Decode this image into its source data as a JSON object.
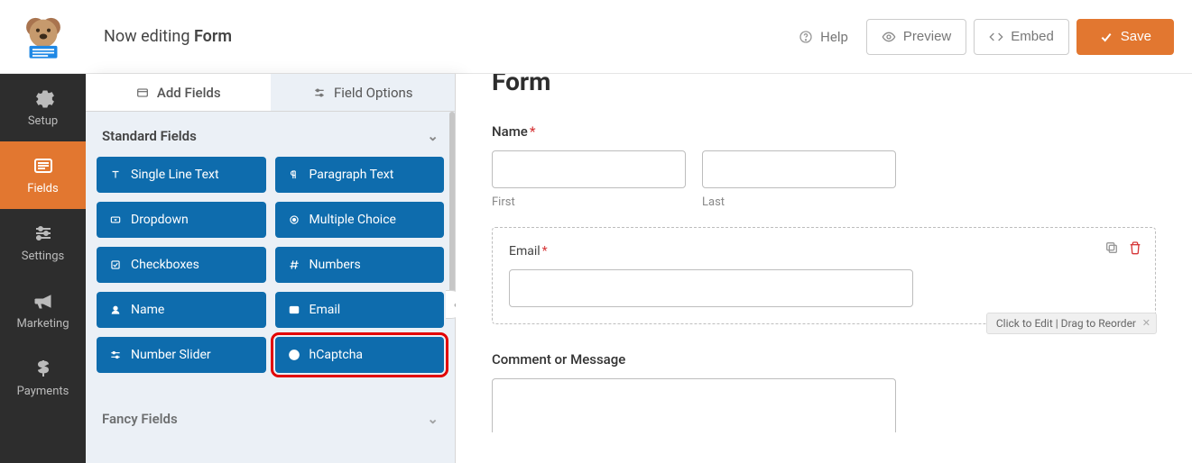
{
  "header": {
    "editing_prefix": "Now editing ",
    "editing_name": "Form",
    "help": "Help",
    "preview": "Preview",
    "embed": "Embed",
    "save": "Save"
  },
  "nav": {
    "setup": "Setup",
    "fields": "Fields",
    "settings": "Settings",
    "marketing": "Marketing",
    "payments": "Payments"
  },
  "panel": {
    "tabs": {
      "add": "Add Fields",
      "options": "Field Options"
    },
    "section_standard": "Standard Fields",
    "section_fancy": "Fancy Fields",
    "items": [
      "Single Line Text",
      "Paragraph Text",
      "Dropdown",
      "Multiple Choice",
      "Checkboxes",
      "Numbers",
      "Name",
      "Email",
      "Number Slider",
      "hCaptcha"
    ]
  },
  "form": {
    "title": "Form",
    "name_label": "Name",
    "first": "First",
    "last": "Last",
    "email_label": "Email",
    "comment_label": "Comment or Message",
    "hint": "Click to Edit | Drag to Reorder"
  },
  "colors": {
    "primary": "#e27730",
    "field": "#0e6cad"
  }
}
